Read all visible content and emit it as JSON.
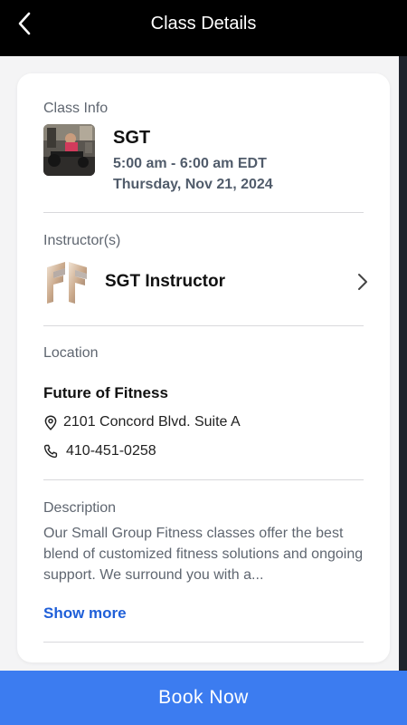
{
  "header": {
    "title": "Class Details",
    "back_icon": "chevron-left-icon"
  },
  "class_info": {
    "section_label": "Class Info",
    "name": "SGT",
    "time": "5:00 am - 6:00 am EDT",
    "date": "Thursday, Nov 21, 2024"
  },
  "instructors": {
    "section_label": "Instructor(s)",
    "items": [
      {
        "name": "SGT Instructor",
        "icon": "chevron-right-icon"
      }
    ]
  },
  "location": {
    "section_label": "Location",
    "name": "Future of Fitness",
    "address": "2101 Concord Blvd. Suite A",
    "phone": "410-451-0258",
    "address_icon": "map-pin-icon",
    "phone_icon": "phone-icon"
  },
  "description": {
    "section_label": "Description",
    "text": "Our Small Group Fitness classes offer the best blend of customized fitness solutions and ongoing support. We surround you with a...",
    "show_more_label": "Show more"
  },
  "actions": {
    "book_label": "Book Now"
  },
  "colors": {
    "header_bg": "#000000",
    "primary": "#3c7cf0",
    "link": "#1f5fd8",
    "muted_text": "#5f6670"
  }
}
